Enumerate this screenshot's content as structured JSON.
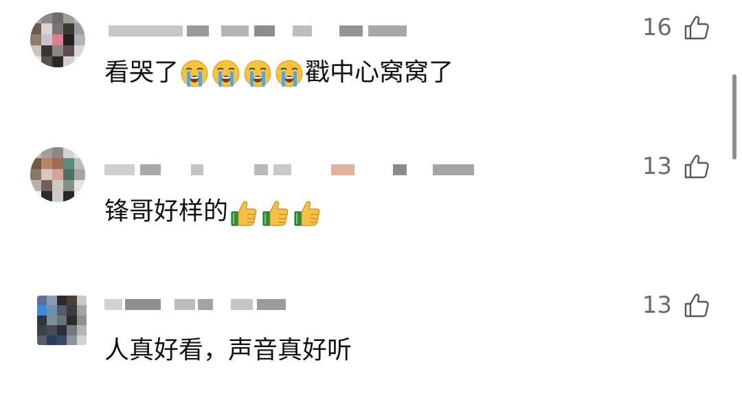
{
  "comments": [
    {
      "text": "看哭了",
      "text_after": "戳中心窝窝了",
      "emoji_name": "loudly-crying-face",
      "emoji_count": 4,
      "likes": "16"
    },
    {
      "text": "锋哥好样的",
      "text_after": "",
      "emoji_name": "thumbs-up",
      "emoji_count": 3,
      "likes": "13"
    },
    {
      "text": "人真好看，声音真好听",
      "text_after": "",
      "emoji_name": "",
      "emoji_count": 0,
      "likes": "13"
    }
  ],
  "icons": {
    "like": "thumbs-up-outline-icon"
  },
  "colors": {
    "text": "#111111",
    "like_count": "#6b6b6b",
    "like_icon": "#555555",
    "scrollbar": "#8e8e8e"
  }
}
